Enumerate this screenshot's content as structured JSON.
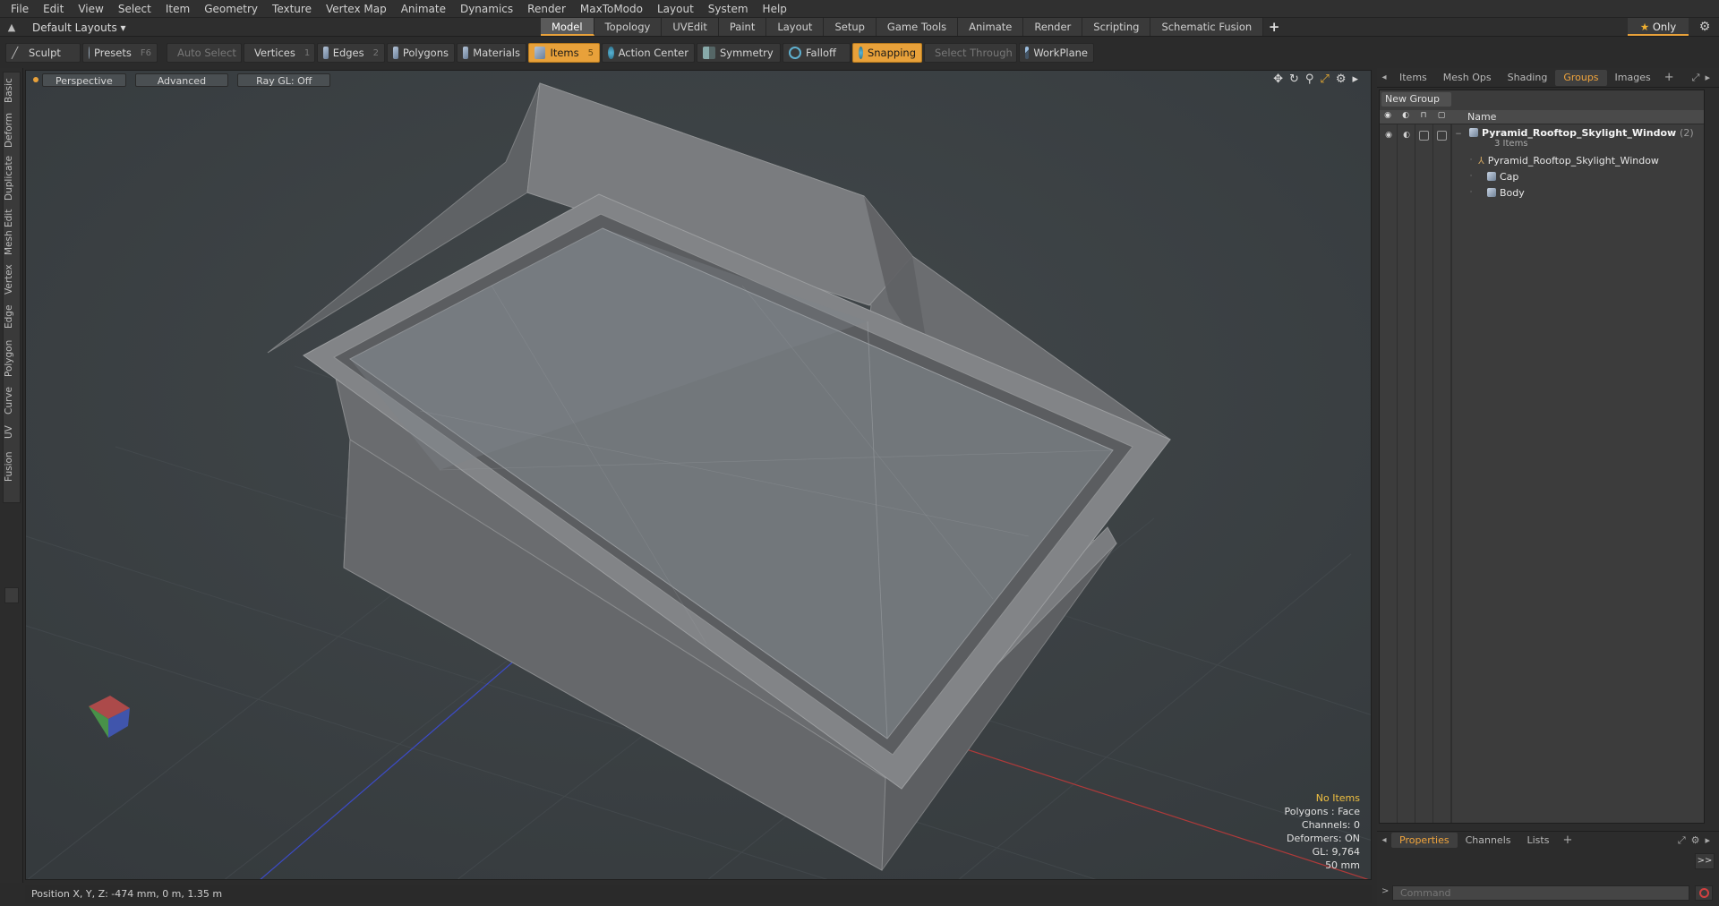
{
  "menu": [
    "File",
    "Edit",
    "View",
    "Select",
    "Item",
    "Geometry",
    "Texture",
    "Vertex Map",
    "Animate",
    "Dynamics",
    "Render",
    "MaxToModo",
    "Layout",
    "System",
    "Help"
  ],
  "layout_menu": "Default Layouts ▾",
  "layout_tabs": [
    "Model",
    "Topology",
    "UVEdit",
    "Paint",
    "Layout",
    "Setup",
    "Game Tools",
    "Animate",
    "Render",
    "Scripting",
    "Schematic Fusion"
  ],
  "active_layout_tab": "Model",
  "only_label": "Only",
  "toolbar": {
    "sculpt": "Sculpt",
    "presets": "Presets",
    "presets_key": "F6",
    "auto_select": "Auto Select",
    "vertices": "Vertices",
    "vertices_key": "1",
    "edges": "Edges",
    "edges_key": "2",
    "polygons": "Polygons",
    "materials": "Materials",
    "items": "Items",
    "items_key": "5",
    "action_center": "Action Center",
    "symmetry": "Symmetry",
    "falloff": "Falloff",
    "snapping": "Snapping",
    "select_through": "Select Through",
    "workplane": "WorkPlane"
  },
  "left_tabs": [
    "Basic",
    "Deform",
    "Duplicate",
    "Mesh Edit",
    "Vertex",
    "Edge",
    "Polygon",
    "Curve",
    "UV",
    "Fusion"
  ],
  "viewport": {
    "view_mode": "Perspective",
    "shading": "Advanced",
    "raygl": "Ray GL: Off",
    "info": {
      "selection": "No Items",
      "polygons": "Polygons : Face",
      "channels": "Channels: 0",
      "deformers": "Deformers: ON",
      "gl": "GL: 9,764",
      "lens": "50 mm"
    }
  },
  "status_bar": "Position X, Y, Z:  -474 mm, 0 m, 1.35 m",
  "right_panel": {
    "tabs": [
      "Items",
      "Mesh Ops",
      "Shading",
      "Groups",
      "Images"
    ],
    "active_tab": "Groups",
    "new_group": "New Group",
    "column_name": "Name",
    "group": {
      "name": "Pyramid_Rooftop_Skylight_Window",
      "count": "(2)",
      "sub": "3 Items",
      "children": [
        "Pyramid_Rooftop_Skylight_Window",
        "Cap",
        "Body"
      ]
    },
    "bottom_tabs": [
      "Properties",
      "Channels",
      "Lists"
    ],
    "active_bottom_tab": "Properties",
    "expand": ">>",
    "command_placeholder": "Command"
  },
  "colors": {
    "accent": "#e8a13a",
    "viewport_bg": "#3b4144",
    "mesh_gray": "#7d7e80"
  }
}
